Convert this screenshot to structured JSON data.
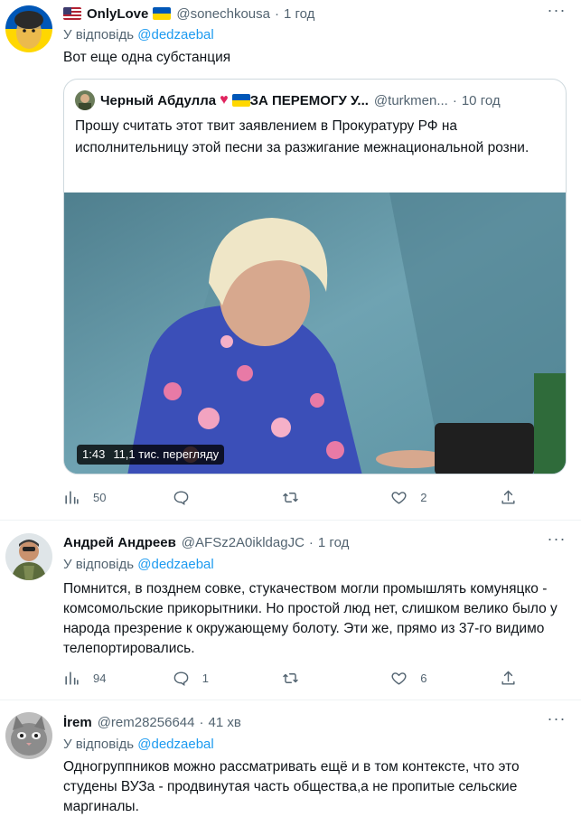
{
  "tweets": [
    {
      "name": "OnlyLove",
      "handle": "@sonechkousa",
      "time": "1 год",
      "reply_prefix": "У відповідь",
      "reply_to": "@dedzaebal",
      "text": "Вот еще одна субстанция",
      "quote": {
        "name": "Черный Абдулла",
        "name_suffix": "ЗА ПЕРЕМОГУ У...",
        "handle": "@turkmen...",
        "time": "10 год",
        "text": "Прошу считать этот твит заявлением в Прокуратуру РФ на исполнительницу этой песни за разжигание межнациональной розни.",
        "media_duration": "1:43",
        "media_views": "11,1 тис. перегляду"
      },
      "actions": {
        "views": "50",
        "replies": "",
        "retweets": "",
        "likes": "2"
      }
    },
    {
      "name": "Андрей Андреев",
      "handle": "@AFSz2A0ikldagJC",
      "time": "1 год",
      "reply_prefix": "У відповідь",
      "reply_to": "@dedzaebal",
      "text": "Помнится, в позднем совке, стукачеством могли промышлять комуняцко - комсомольские прикорытники. Но простой люд нет, слишком велико было у народа презрение к окружающему болоту. Эти же, прямо из 37-го видимо телепортировались.",
      "actions": {
        "views": "94",
        "replies": "1",
        "retweets": "",
        "likes": "6"
      }
    },
    {
      "name": "İrem",
      "handle": "@rem28256644",
      "time": "41 хв",
      "reply_prefix": "У відповідь",
      "reply_to": "@dedzaebal",
      "text": "Одногруппников можно рассматривать ещё и в том контексте, что это студены ВУЗа - продвинутая часть общества,а не пропитые сельские маргиналы."
    }
  ],
  "colors": {
    "accent": "#1d9bf0",
    "muted": "#536471",
    "text": "#0f1419",
    "border": "#cfd9de"
  }
}
